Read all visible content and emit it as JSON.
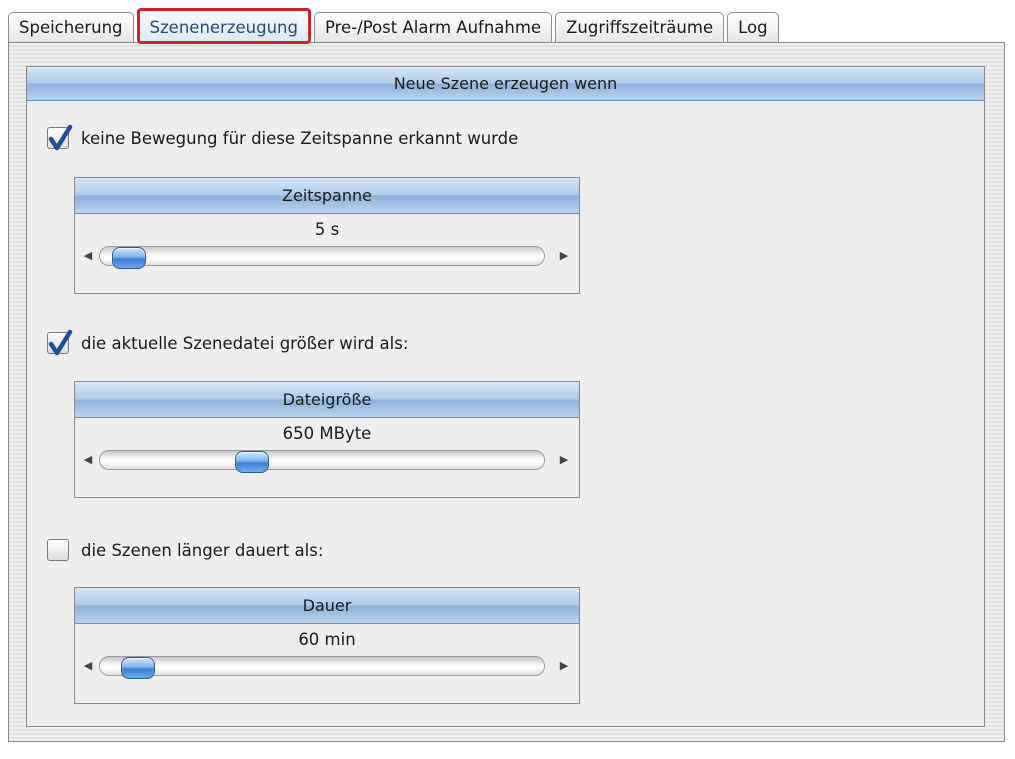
{
  "tabs": [
    {
      "label": "Speicherung",
      "active": false
    },
    {
      "label": "Szenenerzeugung",
      "active": true
    },
    {
      "label": "Pre-/Post Alarm Aufnahme",
      "active": false
    },
    {
      "label": "Zugriffszeiträume",
      "active": false
    },
    {
      "label": "Log",
      "active": false
    }
  ],
  "panel": {
    "header": "Neue Szene erzeugen wenn"
  },
  "conditions": [
    {
      "checkbox_label": "keine Bewegung für diese Zeitspanne erkannt wurde",
      "checked": true,
      "slider_title": "Zeitspanne",
      "slider_value": "5 s",
      "slider_fraction": 0.03
    },
    {
      "checkbox_label": "die aktuelle Szenedatei größer wird als:",
      "checked": true,
      "slider_title": "Dateigröße",
      "slider_value": "650 MByte",
      "slider_fraction": 0.33
    },
    {
      "checkbox_label": "die Szenen länger dauert als:",
      "checked": false,
      "slider_title": "Dauer",
      "slider_value": "60 min",
      "slider_fraction": 0.05
    }
  ],
  "icons": {
    "check": "check-icon",
    "left": "arrow-left-icon",
    "right": "arrow-right-icon"
  },
  "colors": {
    "active_tab_highlight": "#d0242c",
    "check_mark": "#1e4f9c",
    "thumb": "#3d7fd4"
  }
}
